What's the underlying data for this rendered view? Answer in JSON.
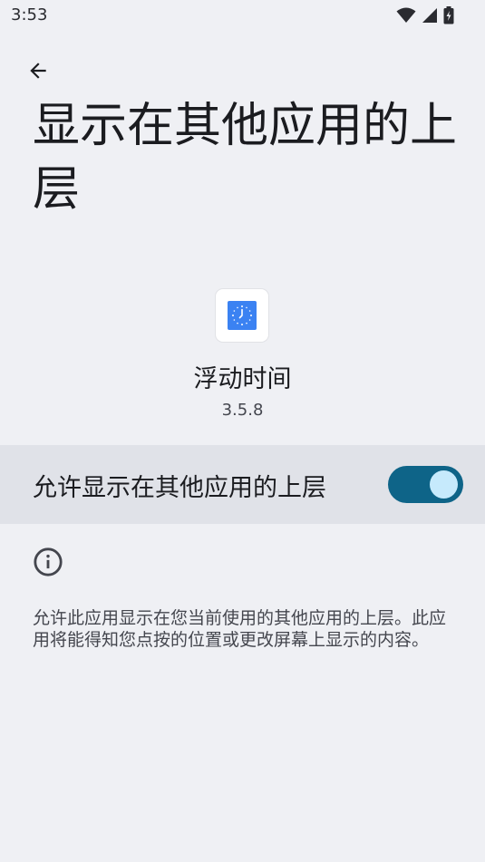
{
  "status_bar": {
    "time": "3:53",
    "icons": [
      "wifi-icon",
      "cellular-signal-icon",
      "battery-charging-icon"
    ]
  },
  "header": {
    "back_icon": "arrow-back-icon",
    "title": "显示在其他应用的上层"
  },
  "app": {
    "icon": "clock-app-icon",
    "icon_color": "#3b82f2",
    "name": "浮动时间",
    "version": "3.5.8"
  },
  "permission_toggle": {
    "label": "允许显示在其他应用的上层",
    "enabled": true,
    "track_color": "#0e6488",
    "thumb_color": "#c6eafc"
  },
  "info": {
    "icon": "info-icon",
    "description": "允许此应用显示在您当前使用的其他应用的上层。此应用将能得知您点按的位置或更改屏幕上显示的内容。"
  },
  "colors": {
    "background": "#eff0f4",
    "row_highlight": "#e0e2e8"
  }
}
